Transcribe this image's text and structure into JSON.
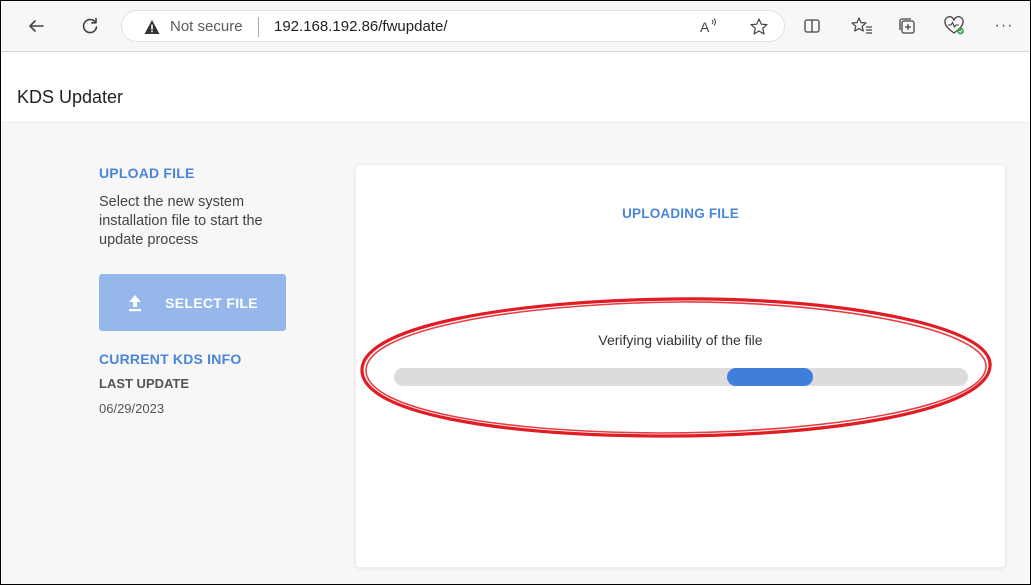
{
  "browser": {
    "security_label": "Not secure",
    "url": "192.168.192.86/fwupdate/",
    "read_aloud_label": "A",
    "more_label": "···",
    "icons": {
      "back": "back-arrow-icon",
      "refresh": "refresh-icon",
      "warning": "warning-icon",
      "read_aloud": "read-aloud-icon",
      "favorite": "star-icon",
      "split_screen": "split-screen-icon",
      "favorites_bar": "favorites-icon",
      "collections": "collections-icon",
      "health": "browser-essentials-icon",
      "more": "more-icon"
    }
  },
  "app": {
    "title": "KDS Updater"
  },
  "sidebar": {
    "upload_heading": "UPLOAD FILE",
    "upload_description": "Select the new system installation file to start the update process",
    "select_button_label": "SELECT FILE",
    "info_heading": "CURRENT KDS INFO",
    "last_update_label": "LAST UPDATE",
    "last_update_value": "06/29/2023"
  },
  "upload_panel": {
    "title": "UPLOADING FILE",
    "status_text": "Verifying viability of the file",
    "progress": {
      "indeterminate": true,
      "indicator_start_percent": 58,
      "indicator_width_percent": 15
    }
  },
  "colors": {
    "accent": "#4a86d8",
    "button_disabled": "#95b7ea",
    "progress_fill": "#3f7fd9",
    "progress_track": "#dcdcdc",
    "annotation": "#e01d25"
  }
}
